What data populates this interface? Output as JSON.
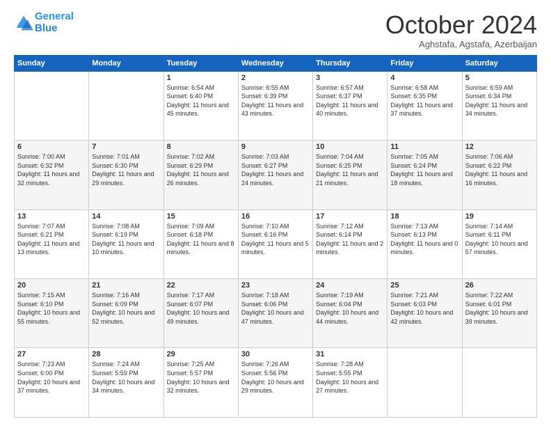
{
  "logo": {
    "line1": "General",
    "line2": "Blue"
  },
  "header": {
    "month": "October 2024",
    "location": "Aghstafa, Agstafa, Azerbaijan"
  },
  "days_of_week": [
    "Sunday",
    "Monday",
    "Tuesday",
    "Wednesday",
    "Thursday",
    "Friday",
    "Saturday"
  ],
  "weeks": [
    [
      {
        "day": "",
        "sunrise": "",
        "sunset": "",
        "daylight": ""
      },
      {
        "day": "",
        "sunrise": "",
        "sunset": "",
        "daylight": ""
      },
      {
        "day": "1",
        "sunrise": "Sunrise: 6:54 AM",
        "sunset": "Sunset: 6:40 PM",
        "daylight": "Daylight: 11 hours and 45 minutes."
      },
      {
        "day": "2",
        "sunrise": "Sunrise: 6:55 AM",
        "sunset": "Sunset: 6:39 PM",
        "daylight": "Daylight: 11 hours and 43 minutes."
      },
      {
        "day": "3",
        "sunrise": "Sunrise: 6:57 AM",
        "sunset": "Sunset: 6:37 PM",
        "daylight": "Daylight: 11 hours and 40 minutes."
      },
      {
        "day": "4",
        "sunrise": "Sunrise: 6:58 AM",
        "sunset": "Sunset: 6:35 PM",
        "daylight": "Daylight: 11 hours and 37 minutes."
      },
      {
        "day": "5",
        "sunrise": "Sunrise: 6:59 AM",
        "sunset": "Sunset: 6:34 PM",
        "daylight": "Daylight: 11 hours and 34 minutes."
      }
    ],
    [
      {
        "day": "6",
        "sunrise": "Sunrise: 7:00 AM",
        "sunset": "Sunset: 6:32 PM",
        "daylight": "Daylight: 11 hours and 32 minutes."
      },
      {
        "day": "7",
        "sunrise": "Sunrise: 7:01 AM",
        "sunset": "Sunset: 6:30 PM",
        "daylight": "Daylight: 11 hours and 29 minutes."
      },
      {
        "day": "8",
        "sunrise": "Sunrise: 7:02 AM",
        "sunset": "Sunset: 6:29 PM",
        "daylight": "Daylight: 11 hours and 26 minutes."
      },
      {
        "day": "9",
        "sunrise": "Sunrise: 7:03 AM",
        "sunset": "Sunset: 6:27 PM",
        "daylight": "Daylight: 11 hours and 24 minutes."
      },
      {
        "day": "10",
        "sunrise": "Sunrise: 7:04 AM",
        "sunset": "Sunset: 6:25 PM",
        "daylight": "Daylight: 11 hours and 21 minutes."
      },
      {
        "day": "11",
        "sunrise": "Sunrise: 7:05 AM",
        "sunset": "Sunset: 6:24 PM",
        "daylight": "Daylight: 11 hours and 18 minutes."
      },
      {
        "day": "12",
        "sunrise": "Sunrise: 7:06 AM",
        "sunset": "Sunset: 6:22 PM",
        "daylight": "Daylight: 11 hours and 16 minutes."
      }
    ],
    [
      {
        "day": "13",
        "sunrise": "Sunrise: 7:07 AM",
        "sunset": "Sunset: 6:21 PM",
        "daylight": "Daylight: 11 hours and 13 minutes."
      },
      {
        "day": "14",
        "sunrise": "Sunrise: 7:08 AM",
        "sunset": "Sunset: 6:19 PM",
        "daylight": "Daylight: 11 hours and 10 minutes."
      },
      {
        "day": "15",
        "sunrise": "Sunrise: 7:09 AM",
        "sunset": "Sunset: 6:18 PM",
        "daylight": "Daylight: 11 hours and 8 minutes."
      },
      {
        "day": "16",
        "sunrise": "Sunrise: 7:10 AM",
        "sunset": "Sunset: 6:16 PM",
        "daylight": "Daylight: 11 hours and 5 minutes."
      },
      {
        "day": "17",
        "sunrise": "Sunrise: 7:12 AM",
        "sunset": "Sunset: 6:14 PM",
        "daylight": "Daylight: 11 hours and 2 minutes."
      },
      {
        "day": "18",
        "sunrise": "Sunrise: 7:13 AM",
        "sunset": "Sunset: 6:13 PM",
        "daylight": "Daylight: 11 hours and 0 minutes."
      },
      {
        "day": "19",
        "sunrise": "Sunrise: 7:14 AM",
        "sunset": "Sunset: 6:11 PM",
        "daylight": "Daylight: 10 hours and 57 minutes."
      }
    ],
    [
      {
        "day": "20",
        "sunrise": "Sunrise: 7:15 AM",
        "sunset": "Sunset: 6:10 PM",
        "daylight": "Daylight: 10 hours and 55 minutes."
      },
      {
        "day": "21",
        "sunrise": "Sunrise: 7:16 AM",
        "sunset": "Sunset: 6:09 PM",
        "daylight": "Daylight: 10 hours and 52 minutes."
      },
      {
        "day": "22",
        "sunrise": "Sunrise: 7:17 AM",
        "sunset": "Sunset: 6:07 PM",
        "daylight": "Daylight: 10 hours and 49 minutes."
      },
      {
        "day": "23",
        "sunrise": "Sunrise: 7:18 AM",
        "sunset": "Sunset: 6:06 PM",
        "daylight": "Daylight: 10 hours and 47 minutes."
      },
      {
        "day": "24",
        "sunrise": "Sunrise: 7:19 AM",
        "sunset": "Sunset: 6:04 PM",
        "daylight": "Daylight: 10 hours and 44 minutes."
      },
      {
        "day": "25",
        "sunrise": "Sunrise: 7:21 AM",
        "sunset": "Sunset: 6:03 PM",
        "daylight": "Daylight: 10 hours and 42 minutes."
      },
      {
        "day": "26",
        "sunrise": "Sunrise: 7:22 AM",
        "sunset": "Sunset: 6:01 PM",
        "daylight": "Daylight: 10 hours and 39 minutes."
      }
    ],
    [
      {
        "day": "27",
        "sunrise": "Sunrise: 7:23 AM",
        "sunset": "Sunset: 6:00 PM",
        "daylight": "Daylight: 10 hours and 37 minutes."
      },
      {
        "day": "28",
        "sunrise": "Sunrise: 7:24 AM",
        "sunset": "Sunset: 5:59 PM",
        "daylight": "Daylight: 10 hours and 34 minutes."
      },
      {
        "day": "29",
        "sunrise": "Sunrise: 7:25 AM",
        "sunset": "Sunset: 5:57 PM",
        "daylight": "Daylight: 10 hours and 32 minutes."
      },
      {
        "day": "30",
        "sunrise": "Sunrise: 7:26 AM",
        "sunset": "Sunset: 5:56 PM",
        "daylight": "Daylight: 10 hours and 29 minutes."
      },
      {
        "day": "31",
        "sunrise": "Sunrise: 7:28 AM",
        "sunset": "Sunset: 5:55 PM",
        "daylight": "Daylight: 10 hours and 27 minutes."
      },
      {
        "day": "",
        "sunrise": "",
        "sunset": "",
        "daylight": ""
      },
      {
        "day": "",
        "sunrise": "",
        "sunset": "",
        "daylight": ""
      }
    ]
  ]
}
